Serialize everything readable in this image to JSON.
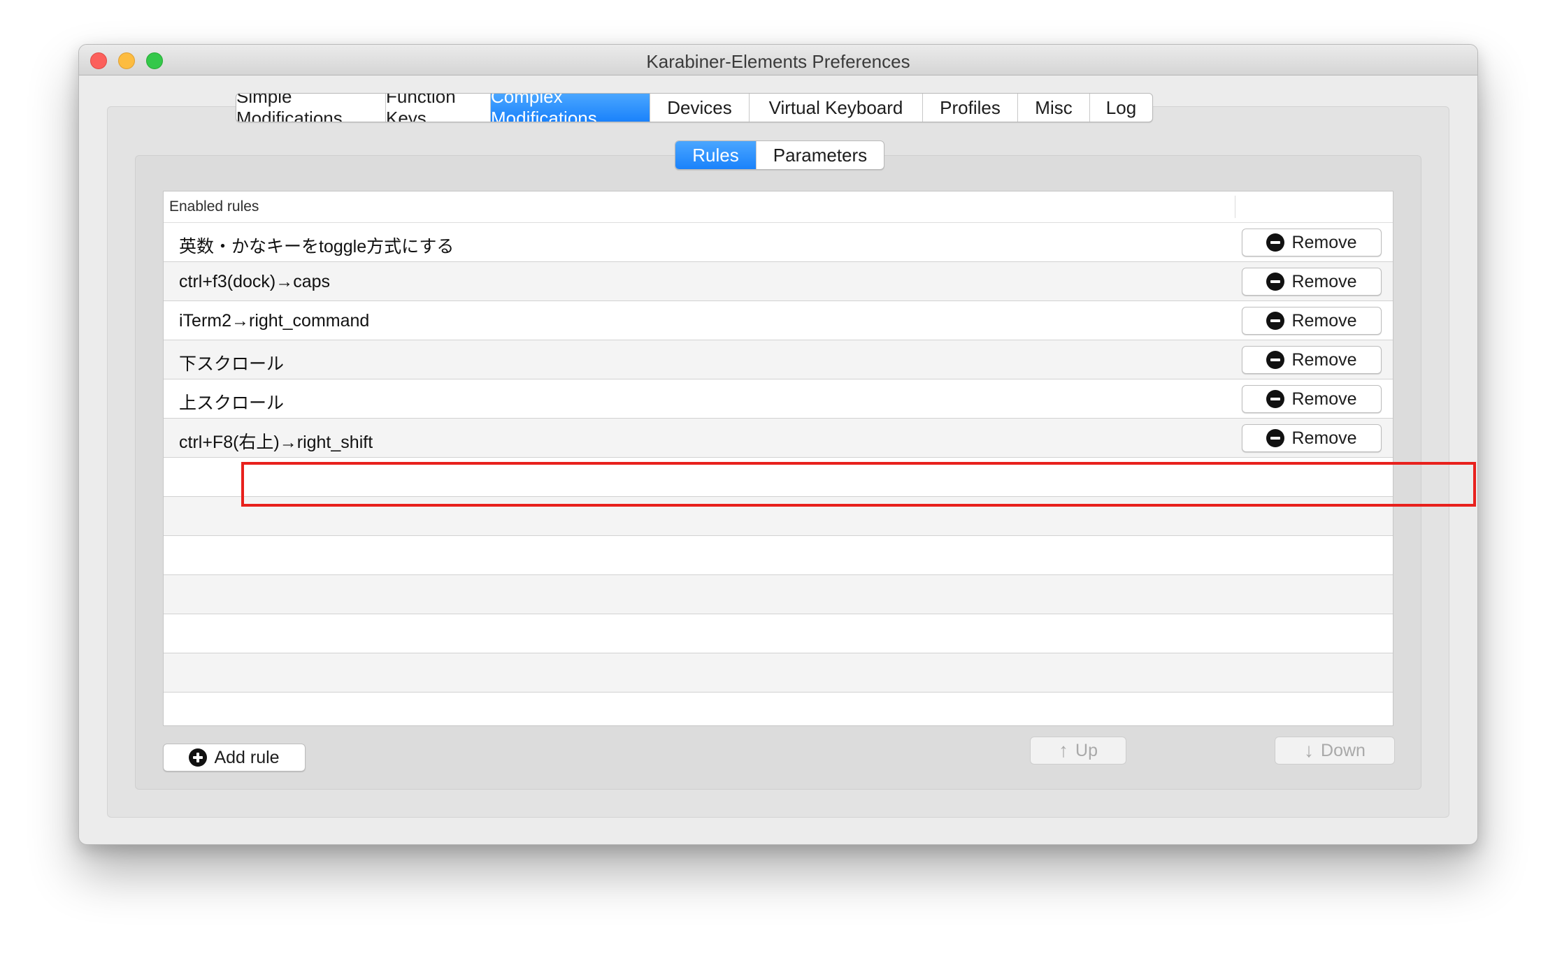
{
  "window": {
    "title": "Karabiner-Elements Preferences"
  },
  "tabs": [
    {
      "label": "Simple Modifications",
      "active": false
    },
    {
      "label": "Function Keys",
      "active": false
    },
    {
      "label": "Complex Modifications",
      "active": true
    },
    {
      "label": "Devices",
      "active": false
    },
    {
      "label": "Virtual Keyboard",
      "active": false
    },
    {
      "label": "Profiles",
      "active": false
    },
    {
      "label": "Misc",
      "active": false
    },
    {
      "label": "Log",
      "active": false
    }
  ],
  "subtabs": [
    {
      "label": "Rules",
      "active": true
    },
    {
      "label": "Parameters",
      "active": false
    }
  ],
  "table": {
    "header": "Enabled rules",
    "rows": [
      {
        "label": "英数・かなキーをtoggle方式にする",
        "button": "Remove"
      },
      {
        "label": "ctrl+f3(dock)→caps",
        "button": "Remove"
      },
      {
        "label": "iTerm2→right_command",
        "button": "Remove"
      },
      {
        "label": "下スクロール",
        "button": "Remove"
      },
      {
        "label": "上スクロール",
        "button": "Remove"
      },
      {
        "label": "ctrl+F8(右上)→right_shift",
        "button": "Remove"
      }
    ]
  },
  "buttons": {
    "add": "Add rule",
    "up": "Up",
    "down": "Down"
  },
  "colors": {
    "accent": "#1a82fb",
    "highlight": "#e8211d"
  }
}
